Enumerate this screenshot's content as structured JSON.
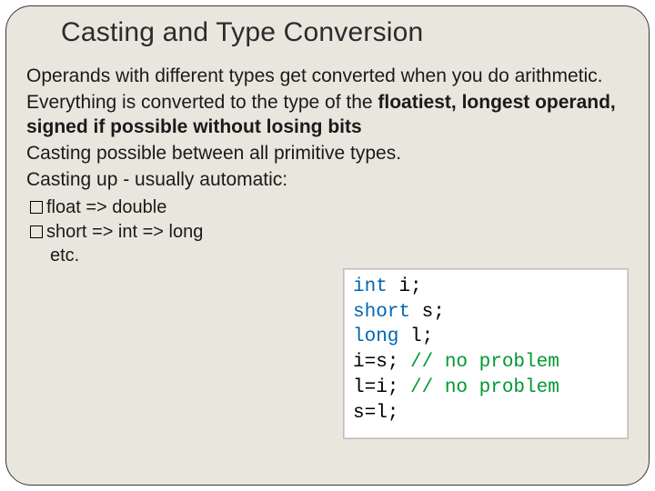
{
  "title": "Casting and Type Conversion",
  "p1": "Operands with different types get converted when you do arithmetic.",
  "p2a": "Everything is converted to the type of the ",
  "p2b": "floatiest, longest operand, signed if possible without losing bits",
  "p3": "Casting possible between all primitive types.",
  "p4": "Casting up - usually automatic:",
  "bullets": {
    "b1": "float => double",
    "b2": "short => int => long",
    "b2_cont": "etc."
  },
  "code": {
    "kw_int": "int",
    "decl_i": " i;",
    "kw_short": "short",
    "decl_s": " s;",
    "kw_long": "long",
    "decl_l": " l;",
    "assign_is": "i=s; ",
    "cm_np1": "// no problem",
    "assign_li": "l=i; ",
    "cm_np2": "// no problem",
    "assign_sl": "s=l;"
  }
}
